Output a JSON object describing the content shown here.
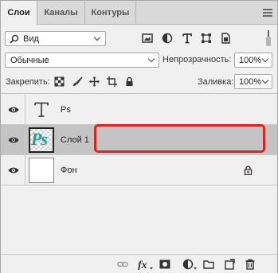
{
  "tabs": [
    {
      "label": "Слои",
      "active": true
    },
    {
      "label": "Каналы",
      "active": false
    },
    {
      "label": "Контуры",
      "active": false
    }
  ],
  "filter": {
    "value": "Вид"
  },
  "blend_mode": {
    "value": "Обычные"
  },
  "opacity": {
    "label": "Непрозрачность:",
    "value": "100%"
  },
  "lock": {
    "label": "Закрепить:"
  },
  "fill": {
    "label": "Заливка:",
    "value": "100%"
  },
  "layers": [
    {
      "name": "Ps",
      "type": "text",
      "visible": true,
      "selected": false
    },
    {
      "name": "Слой 1",
      "type": "raster",
      "visible": true,
      "selected": true,
      "thumb_text": "Ps"
    },
    {
      "name": "Фон",
      "type": "background",
      "visible": true,
      "selected": false,
      "locked": true
    }
  ],
  "colors": {
    "selection": "#c4c4c4",
    "highlight": "#e0241b",
    "thumb_teal": "#1f9e98"
  },
  "bottom_icons": [
    "link-icon",
    "fx-icon",
    "mask-icon",
    "adjustment-icon",
    "folder-icon",
    "new-layer-icon",
    "trash-icon"
  ]
}
